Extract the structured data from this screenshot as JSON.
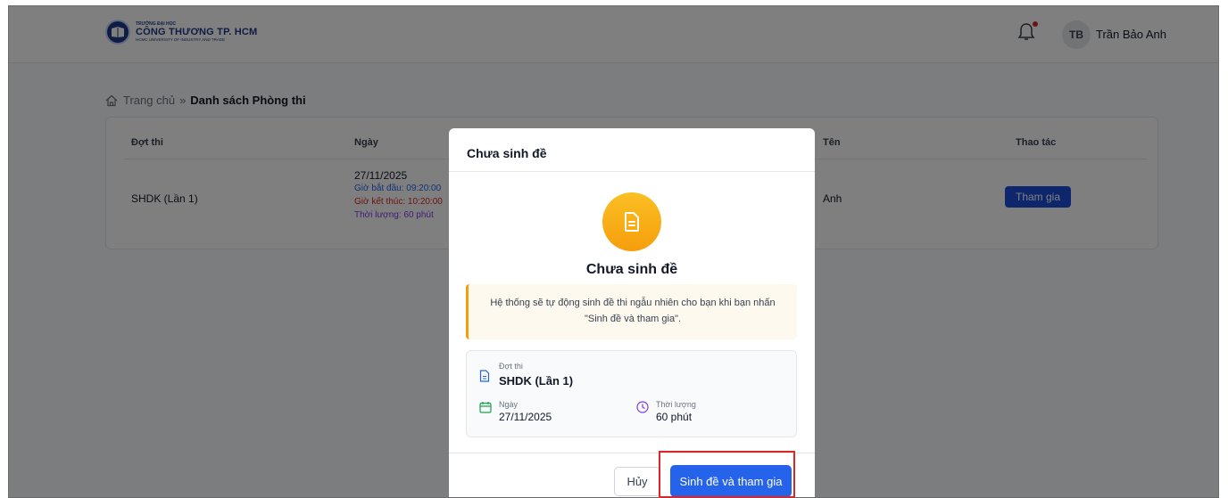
{
  "header": {
    "logo_small": "TRƯỜNG ĐẠI HỌC",
    "logo_main": "CÔNG THƯƠNG TP. HCM",
    "logo_sub": "HCMC UNIVERSITY OF INDUSTRY AND TRADE",
    "avatar_initials": "TB",
    "user_name": "Trần Bảo Anh"
  },
  "breadcrumb": {
    "home": "Trang chủ",
    "separator": "»",
    "current": "Danh sách Phòng thi"
  },
  "table": {
    "columns": [
      "Đợt thi",
      "Ngày",
      "Tên",
      "Thao tác"
    ],
    "row": {
      "exam_round": "SHDK (Lần 1)",
      "date": "27/11/2025",
      "start": "Giờ bắt đầu: 09:20:00",
      "end": "Giờ kết thúc: 10:20:00",
      "duration": "Thời lượng: 60 phút",
      "name": "Anh",
      "action": "Tham gia"
    }
  },
  "modal": {
    "title": "Chưa sinh đề",
    "heading": "Chưa sinh đề",
    "notice": "Hệ thống sẽ tự động sinh đề thi ngẫu nhiên cho bạn khi bạn nhấn \"Sinh đề và tham gia\".",
    "exam_round_label": "Đợt thi",
    "exam_round_value": "SHDK (Lần 1)",
    "date_label": "Ngày",
    "date_value": "27/11/2025",
    "duration_label": "Thời lượng",
    "duration_value": "60 phút",
    "cancel": "Hủy",
    "submit": "Sinh đề và tham gia"
  },
  "colors": {
    "primary": "#2563eb",
    "accent_orange": "#f59e0b",
    "danger": "#dc2626"
  }
}
